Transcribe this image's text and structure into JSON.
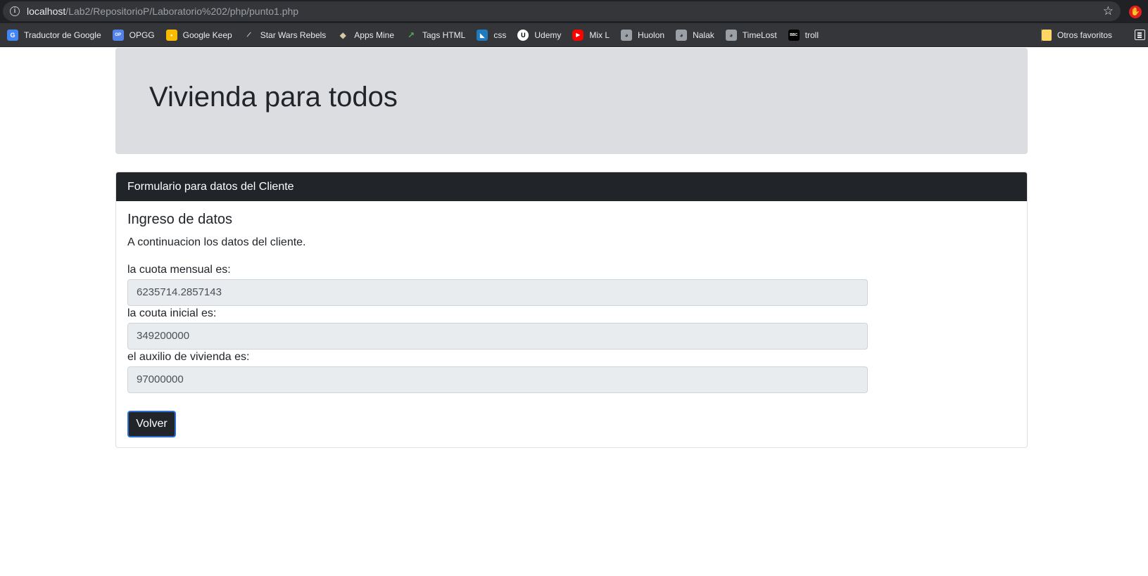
{
  "browser": {
    "url_host": "localhost",
    "url_path": "/Lab2/RepositorioP/Laboratorio%202/php/punto1.php",
    "bookmarks": [
      {
        "label": "Traductor de Google",
        "icon": "google-translate-icon",
        "color": "#4285f4"
      },
      {
        "label": "OPGG",
        "icon": "opgg-icon",
        "color": "#5383e8"
      },
      {
        "label": "Google Keep",
        "icon": "google-keep-icon",
        "color": "#f9bb00"
      },
      {
        "label": "Star Wars Rebels",
        "icon": "star-wars-icon",
        "color": "#9b1c1c"
      },
      {
        "label": "Apps Mine",
        "icon": "apps-mine-icon",
        "color": "#7a6a55"
      },
      {
        "label": "Tags HTML",
        "icon": "tags-html-icon",
        "color": "#3a8f3a"
      },
      {
        "label": "css",
        "icon": "css-icon",
        "color": "#1e7bbf"
      },
      {
        "label": "Udemy",
        "icon": "udemy-icon",
        "color": "#ffffff"
      },
      {
        "label": "Mix L",
        "icon": "youtube-icon",
        "color": "#ff0000"
      },
      {
        "label": "Huolon",
        "icon": "cat-icon",
        "color": "#9aa0a6"
      },
      {
        "label": "Nalak",
        "icon": "cat-icon",
        "color": "#9aa0a6"
      },
      {
        "label": "TimeLost",
        "icon": "cat-icon",
        "color": "#9aa0a6"
      },
      {
        "label": "troll",
        "icon": "bbc-icon",
        "color": "#000000"
      }
    ],
    "other_bookmarks": "Otros favoritos"
  },
  "page": {
    "jumbotron_title": "Vivienda para todos",
    "card_header": "Formulario para datos del Cliente",
    "card_title": "Ingreso de datos",
    "card_text": "A continuacion los datos del cliente.",
    "fields": [
      {
        "label": "la cuota mensual es:",
        "value": "6235714.2857143"
      },
      {
        "label": "la couta inicial es:",
        "value": "349200000"
      },
      {
        "label": "el auxilio de vivienda es:",
        "value": "97000000"
      }
    ],
    "button_label": "Volver"
  },
  "colors": {
    "header_dark": "#212529",
    "jumbotron_bg": "#dcdde0",
    "input_bg": "#e9ecef",
    "focus_blue": "#2f6fd0"
  }
}
